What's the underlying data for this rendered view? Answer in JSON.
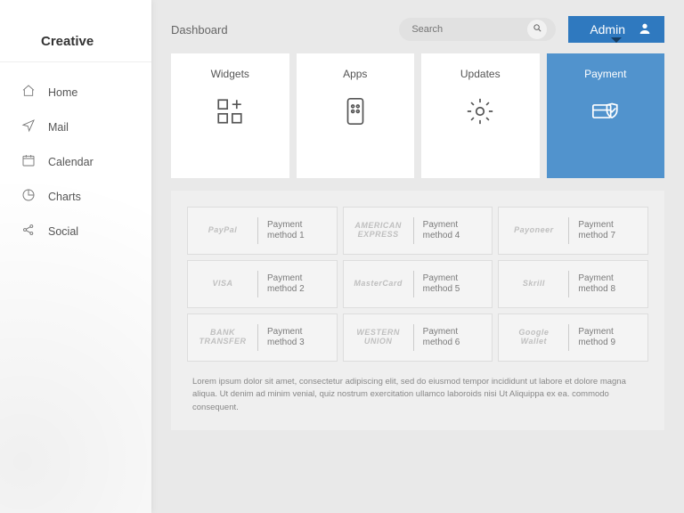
{
  "brand": "Creative",
  "nav": [
    {
      "label": "Home"
    },
    {
      "label": "Mail"
    },
    {
      "label": "Calendar"
    },
    {
      "label": "Charts"
    },
    {
      "label": "Social"
    }
  ],
  "header": {
    "title": "Dashboard",
    "search_placeholder": "Search",
    "admin_label": "Admin"
  },
  "tabs": [
    {
      "label": "Widgets"
    },
    {
      "label": "Apps"
    },
    {
      "label": "Updates"
    },
    {
      "label": "Payment"
    }
  ],
  "payment_methods": [
    {
      "brand": "PayPal",
      "label": "Payment method 1"
    },
    {
      "brand": "VISA",
      "label": "Payment method 2"
    },
    {
      "brand": "BANK TRANSFER",
      "label": "Payment method 3"
    },
    {
      "brand": "AMERICAN EXPRESS",
      "label": "Payment method 4"
    },
    {
      "brand": "MasterCard",
      "label": "Payment method 5"
    },
    {
      "brand": "WESTERN UNION",
      "label": "Payment method 6"
    },
    {
      "brand": "Payoneer",
      "label": "Payment method 7"
    },
    {
      "brand": "Skrill",
      "label": "Payment method 8"
    },
    {
      "brand": "Google Wallet",
      "label": "Payment method 9"
    }
  ],
  "lorem": "Lorem ipsum dolor sit amet, consectetur adipiscing elit, sed do eiusmod tempor incididunt ut labore et dolore magna aliqua. Ut denim ad minim venial, quiz nostrum exercitation ullamco laboroids nisi Ut Aliquippa ex ea. commodo consequent."
}
